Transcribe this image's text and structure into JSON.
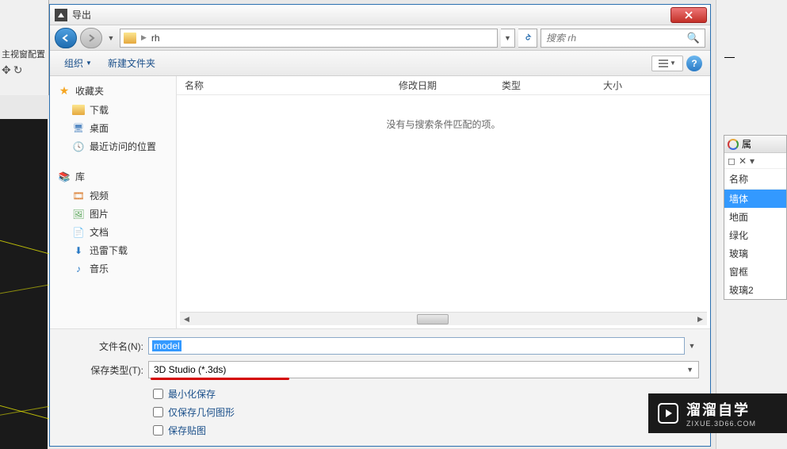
{
  "window": {
    "title": "导出"
  },
  "nav": {
    "breadcrumb_folder": "rh",
    "search_placeholder": "搜索 rh"
  },
  "toolbar": {
    "organize": "组织",
    "new_folder": "新建文件夹"
  },
  "sidebar": {
    "favorites": "收藏夹",
    "downloads": "下载",
    "desktop": "桌面",
    "recent": "最近访问的位置",
    "libraries": "库",
    "videos": "视频",
    "pictures": "图片",
    "documents": "文档",
    "thunder": "迅雷下载",
    "music": "音乐"
  },
  "columns": {
    "name": "名称",
    "date": "修改日期",
    "type": "类型",
    "size": "大小"
  },
  "content": {
    "empty": "没有与搜索条件匹配的项。"
  },
  "form": {
    "filename_label": "文件名(N):",
    "filename_value": "model",
    "filetype_label": "保存类型(T):",
    "filetype_value": "3D Studio (*.3ds)",
    "chk_minimize": "最小化保存",
    "chk_geometry": "仅保存几何图形",
    "chk_texture": "保存贴图"
  },
  "left_fragment": {
    "label": "主视窗配置"
  },
  "right_panel": {
    "tab": "属",
    "header": "名称",
    "items": [
      "墙体",
      "地面",
      "绿化",
      "玻璃",
      "窗框",
      "玻璃2"
    ]
  },
  "watermark": {
    "text": "溜溜自学",
    "url": "ZIXUE.3D66.COM"
  }
}
